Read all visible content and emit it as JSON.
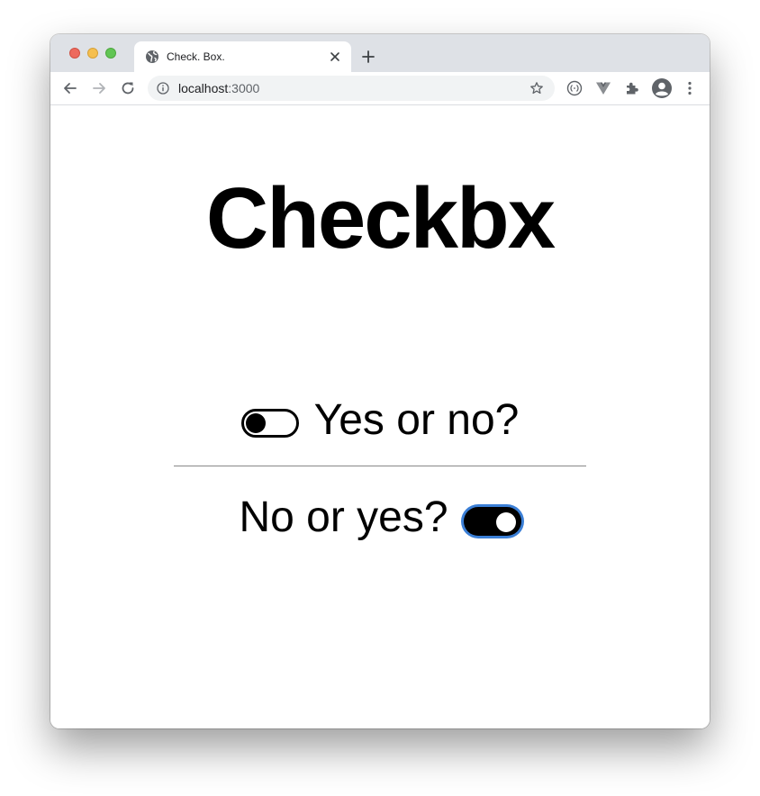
{
  "browser": {
    "tab_title": "Check. Box.",
    "url_host": "localhost",
    "url_port": ":3000"
  },
  "page": {
    "headline": "Checkbx",
    "toggle1": {
      "label": "Yes or no?",
      "checked": false
    },
    "toggle2": {
      "label": "No or yes?",
      "checked": true
    }
  },
  "colors": {
    "focus_ring": "#3b7fd6",
    "titlebar": "#dee1e6"
  },
  "icons": [
    "globe-icon",
    "close-icon",
    "plus-icon",
    "back-arrow-icon",
    "forward-arrow-icon",
    "reload-icon",
    "info-icon",
    "star-icon",
    "extension-icon",
    "vue-icon",
    "puzzle-icon",
    "profile-icon",
    "kebab-menu-icon"
  ]
}
